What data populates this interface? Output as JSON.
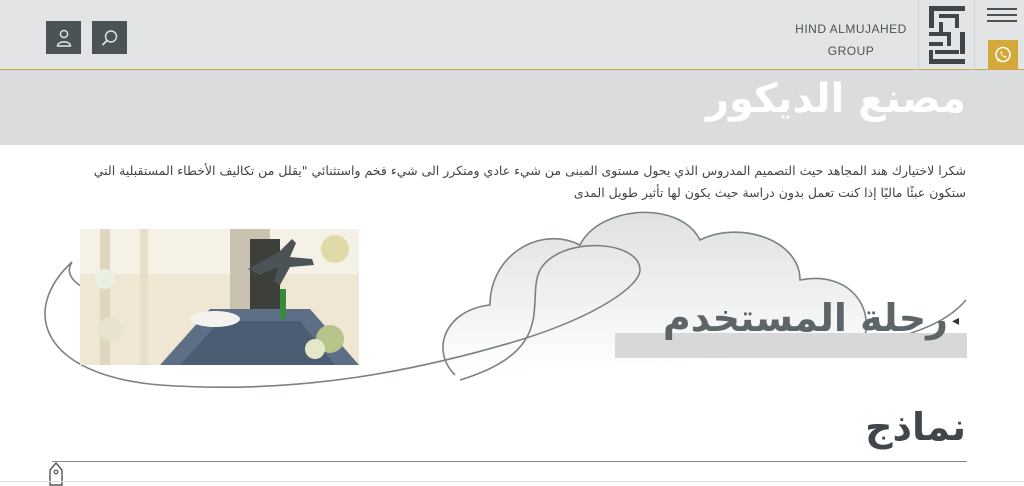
{
  "header": {
    "brand_line1": "HIND ALMUJAHED",
    "brand_line2": "GROUP",
    "user_icon": "user-icon",
    "search_icon": "search-icon",
    "menu_icon": "hamburger-menu-icon",
    "whatsapp_icon": "whatsapp-icon"
  },
  "banner": {
    "title": "مصنع الديكور"
  },
  "intro": {
    "text": "شكرا لاختيارك هند المجاهد حيث التصميم المدروس الذي يحول مستوى المبنى من شيء عادي ومتكرر الى شيء فخم واستثنائي \"يقلل من تكاليف الأخطاء المستقبلية التي ستكون عبئًا ماليًا إذا كنت تعمل بدون دراسة حيث يكون لها تأثير طويل المدى"
  },
  "journey": {
    "title": "رحلة المستخدم"
  },
  "samples": {
    "title": "نماذج"
  },
  "colors": {
    "accent": "#c9a94b",
    "whatsapp_bg": "#d4a93a",
    "dark_button": "#4b5356",
    "banner_bg": "#dadcdd"
  }
}
